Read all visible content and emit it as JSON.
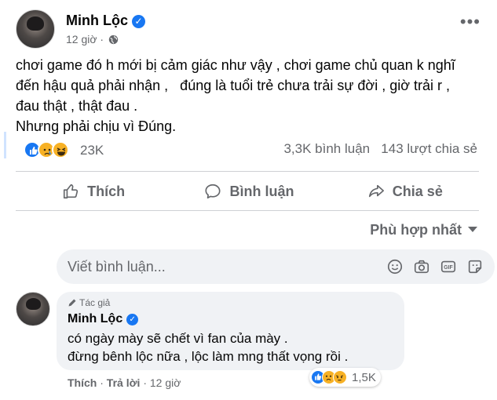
{
  "post": {
    "author": "Minh Lộc",
    "time": "12 giờ",
    "lines": [
      "chơi game đó h mới bị cảm giác như vậy , chơi game chủ quan k nghĩ",
      "đến hậu quả phải nhận ,   đúng là tuổi trẻ chưa trải sự đời , giờ trải r ,",
      "đau thật , thật đau .",
      "Nhưng phải chịu vì Đúng."
    ]
  },
  "stats": {
    "reaction_count": "23K",
    "comments": "3,3K bình luận",
    "shares": "143 lượt chia sẻ",
    "reaction_icons": [
      "like-icon",
      "sad-icon",
      "haha-icon"
    ]
  },
  "actions": {
    "like": "Thích",
    "comment": "Bình luận",
    "share": "Chia sẻ"
  },
  "sort": {
    "label": "Phù hợp nhất"
  },
  "composer": {
    "placeholder": "Viết bình luận...",
    "icons": [
      "smiley-icon",
      "camera-icon",
      "gif-icon",
      "sticker-icon"
    ]
  },
  "comment": {
    "badge": "Tác giả",
    "author": "Minh Lộc",
    "lines": [
      "có ngày mày sẽ chết vì fan của mày .",
      "đừng bênh lộc nữa , lộc làm mng thất vọng rồi ."
    ],
    "reaction_count": "1,5K",
    "like": "Thích",
    "reply": "Trả lời",
    "time": "12 giờ"
  },
  "colors": {
    "brand_blue": "#1877f2",
    "secondary_text": "#65676b",
    "input_bg": "#f0f2f5"
  }
}
